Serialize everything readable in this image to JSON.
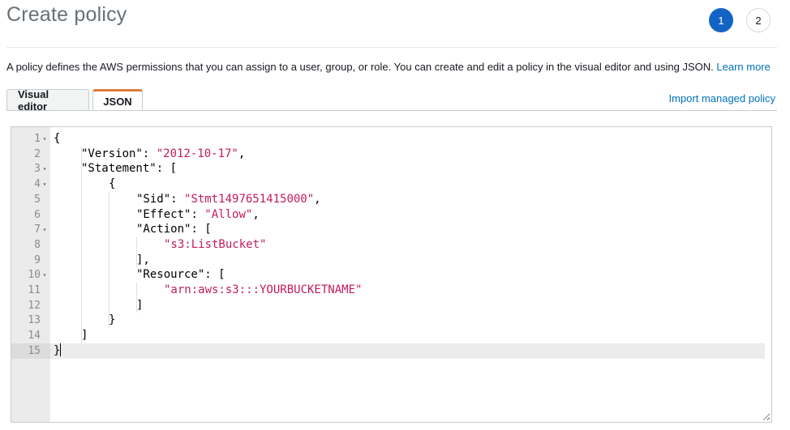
{
  "header": {
    "title": "Create policy",
    "steps": [
      {
        "label": "1",
        "active": true
      },
      {
        "label": "2",
        "active": false
      }
    ]
  },
  "description": {
    "text": "A policy defines the AWS permissions that you can assign to a user, group, or role. You can create and edit a policy in the visual editor and using JSON.",
    "link_label": "Learn more"
  },
  "tabs": [
    {
      "label": "Visual editor",
      "active": false
    },
    {
      "label": "JSON",
      "active": true
    }
  ],
  "import_link": "Import managed policy",
  "editor": {
    "active_line": 15,
    "lines": [
      {
        "num": "1",
        "fold": true,
        "indent": 0,
        "tokens": [
          [
            "p",
            "{"
          ]
        ]
      },
      {
        "num": "2",
        "fold": false,
        "indent": 1,
        "tokens": [
          [
            "k",
            "\"Version\""
          ],
          [
            "p",
            ": "
          ],
          [
            "s",
            "\"2012-10-17\""
          ],
          [
            "p",
            ","
          ]
        ]
      },
      {
        "num": "3",
        "fold": true,
        "indent": 1,
        "tokens": [
          [
            "k",
            "\"Statement\""
          ],
          [
            "p",
            ": ["
          ]
        ]
      },
      {
        "num": "4",
        "fold": true,
        "indent": 2,
        "tokens": [
          [
            "p",
            "{"
          ]
        ]
      },
      {
        "num": "5",
        "fold": false,
        "indent": 3,
        "tokens": [
          [
            "k",
            "\"Sid\""
          ],
          [
            "p",
            ": "
          ],
          [
            "s",
            "\"Stmt1497651415000\""
          ],
          [
            "p",
            ","
          ]
        ]
      },
      {
        "num": "6",
        "fold": false,
        "indent": 3,
        "tokens": [
          [
            "k",
            "\"Effect\""
          ],
          [
            "p",
            ": "
          ],
          [
            "s",
            "\"Allow\""
          ],
          [
            "p",
            ","
          ]
        ]
      },
      {
        "num": "7",
        "fold": true,
        "indent": 3,
        "tokens": [
          [
            "k",
            "\"Action\""
          ],
          [
            "p",
            ": ["
          ]
        ]
      },
      {
        "num": "8",
        "fold": false,
        "indent": 4,
        "tokens": [
          [
            "s",
            "\"s3:ListBucket\""
          ]
        ]
      },
      {
        "num": "9",
        "fold": false,
        "indent": 3,
        "tokens": [
          [
            "p",
            "],"
          ]
        ]
      },
      {
        "num": "10",
        "fold": true,
        "indent": 3,
        "tokens": [
          [
            "k",
            "\"Resource\""
          ],
          [
            "p",
            ": ["
          ]
        ]
      },
      {
        "num": "11",
        "fold": false,
        "indent": 4,
        "tokens": [
          [
            "s",
            "\"arn:aws:s3:::YOURBUCKETNAME\""
          ]
        ]
      },
      {
        "num": "12",
        "fold": false,
        "indent": 3,
        "tokens": [
          [
            "p",
            "]"
          ]
        ]
      },
      {
        "num": "13",
        "fold": false,
        "indent": 2,
        "tokens": [
          [
            "p",
            "}"
          ]
        ]
      },
      {
        "num": "14",
        "fold": false,
        "indent": 1,
        "tokens": [
          [
            "p",
            "]"
          ]
        ]
      },
      {
        "num": "15",
        "fold": false,
        "indent": 0,
        "tokens": [
          [
            "p",
            "}"
          ]
        ]
      }
    ]
  },
  "colors": {
    "accent_blue": "#1264c4",
    "link_blue": "#0073bb",
    "tab_highlight": "#e07b3a",
    "json_string": "#c41a5c"
  }
}
